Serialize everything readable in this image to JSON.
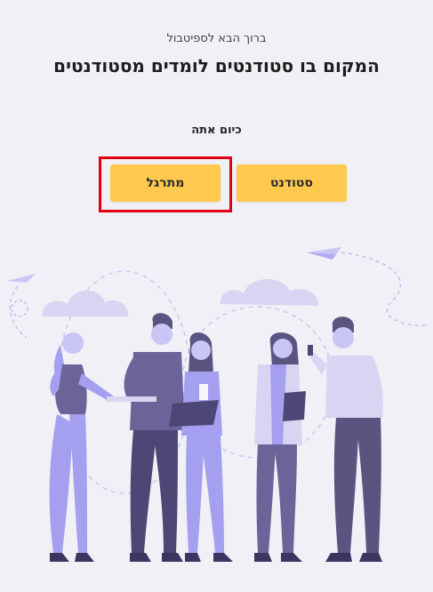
{
  "header": {
    "welcome_text": "ברוך הבא לספיטבול",
    "headline": "המקום בו סטודנטים לומדים מסטודנטים"
  },
  "role_selection": {
    "prompt": "כיום אתה",
    "student_label": "סטודנט",
    "tutor_label": "מתרגל"
  },
  "colors": {
    "background": "#f0f0f6",
    "button_bg": "#ffc94f",
    "highlight": "#e10010",
    "illustration_primary": "#a59ff0",
    "illustration_dark": "#5a5580"
  },
  "illustration": {
    "icon": "group-of-people-illustration"
  }
}
